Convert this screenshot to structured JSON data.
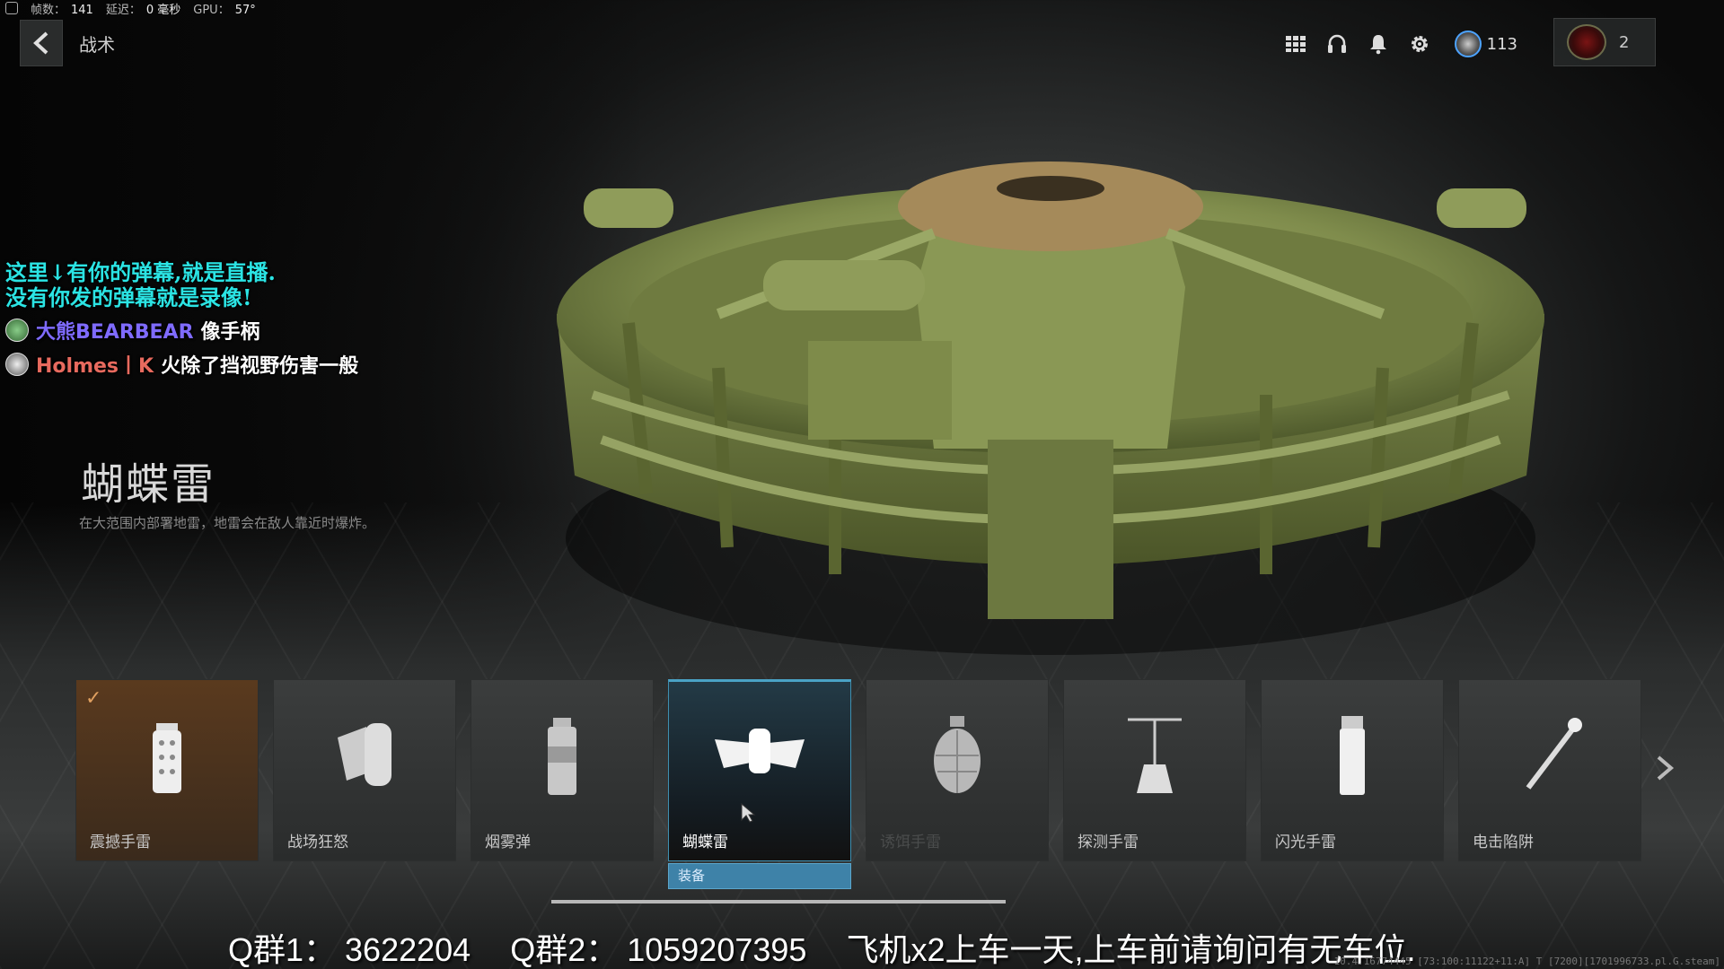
{
  "perf": {
    "fps_label": "帧数：",
    "fps_value": "141",
    "latency_label": "延迟：",
    "latency_value": "0 毫秒",
    "gpu_label": "GPU：",
    "gpu_value": "57°"
  },
  "header": {
    "title": "战术"
  },
  "top_bar": {
    "rank_value": "113",
    "level_value": "2"
  },
  "danmaku": {
    "notice_line1": "这里↓有你的弹幕,就是直播.",
    "notice_line2": "没有你发的弹幕就是录像!",
    "comments": [
      {
        "user": "大熊BEARBEAR",
        "message": "像手柄"
      },
      {
        "user": "Holmes丨K",
        "message": "火除了挡视野伤害一般"
      }
    ]
  },
  "item": {
    "name": "蝴蝶雷",
    "description": "在大范围内部署地雷，地雷会在敌人靠近时爆炸。"
  },
  "cards": [
    {
      "label": "震撼手雷",
      "icon": "stun-grenade-icon",
      "state": "equipped"
    },
    {
      "label": "战场狂怒",
      "icon": "battle-rage-icon",
      "state": "normal"
    },
    {
      "label": "烟雾弹",
      "icon": "smoke-grenade-icon",
      "state": "normal"
    },
    {
      "label": "蝴蝶雷",
      "icon": "butterfly-mine-icon",
      "state": "selected"
    },
    {
      "label": "诱饵手雷",
      "icon": "decoy-grenade-icon",
      "state": "dim"
    },
    {
      "label": "探测手雷",
      "icon": "snapshot-grenade-icon",
      "state": "normal"
    },
    {
      "label": "闪光手雷",
      "icon": "flash-grenade-icon",
      "state": "normal"
    },
    {
      "label": "电击陷阱",
      "icon": "shock-stick-icon",
      "state": "normal"
    }
  ],
  "equip_label": "装备",
  "footer": {
    "group1": "Q群1： 3622204",
    "group2": "Q群2： 1059207395",
    "notice": "飞机x2上车一天,上车前请询问有无车位."
  },
  "build_info": "10.4.16774445 [73:100:11122+11:A] T [7200][1701996733.pl.G.steam]",
  "colors": {
    "accent": "#3e82a8",
    "mine_green": "#8c9a58",
    "equipped": "#5a3a1e",
    "danmaku_notice": "#2be4e4"
  }
}
